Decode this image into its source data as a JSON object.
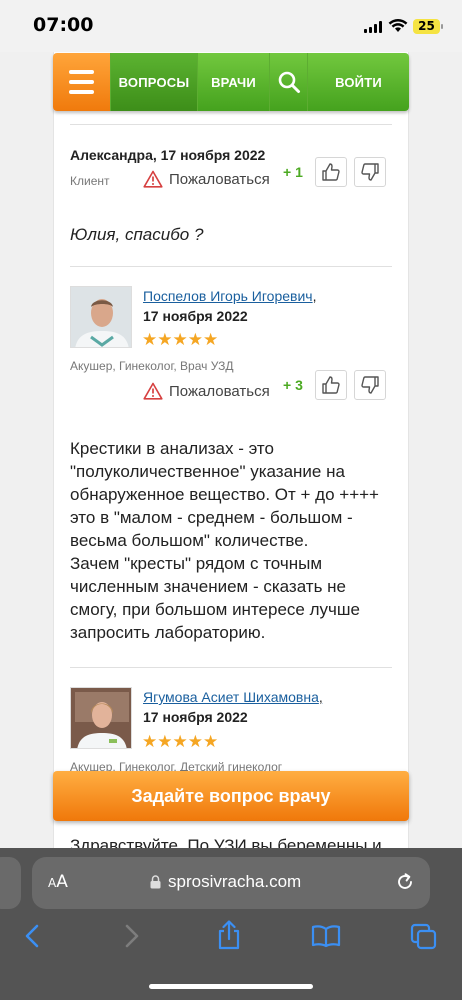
{
  "status": {
    "time": "07:00",
    "battery": "25"
  },
  "nav": {
    "questions": "ВОПРОСЫ",
    "doctors": "ВРАЧИ",
    "search_icon": "search-icon",
    "login": "ВОЙТИ"
  },
  "comment1": {
    "author": "Александра, 17 ноября 2022",
    "role": "Клиент",
    "complain": "Пожаловаться",
    "votes": "+ 1",
    "text": "Юлия, спасибо ?"
  },
  "answer1": {
    "name": "Поспелов Игорь Игоревич",
    "comma": ",",
    "date": "17 ноября 2022",
    "stars": "★★★★★",
    "role": "Акушер, Гинеколог, Врач УЗД",
    "complain": "Пожаловаться",
    "votes": "+ 3",
    "lines": [
      "Крестики в анализах - это",
      "\"полуколичественное\" указание на",
      "обнаруженное вещество. От + до ++++",
      "это в \"малом - среднем - большом -",
      "весьма большом\" количестве.",
      "Зачем \"кресты\" рядом с точным",
      "численным значением - сказать не",
      "смогу, при большом интересе лучше",
      "запросить лабораторию."
    ]
  },
  "answer2": {
    "name": "Ягумова Асиет Шихамовна",
    "comma": ",",
    "date": "17 ноября 2022",
    "stars": "★★★★★",
    "role": "Акушер, Гинеколог, Детский гинеколог",
    "peek": "Здравствуйте. По УЗИ вы беременны и"
  },
  "cta": {
    "label": "Задайте вопрос врачу"
  },
  "browser": {
    "aa_small": "A",
    "aa_big": "A",
    "url": "sprosivracha.com"
  },
  "colors": {
    "green": "#4caa22",
    "orange": "#f28a1c",
    "link": "#1a5f9e",
    "safari_blue": "#3b8ff3"
  }
}
